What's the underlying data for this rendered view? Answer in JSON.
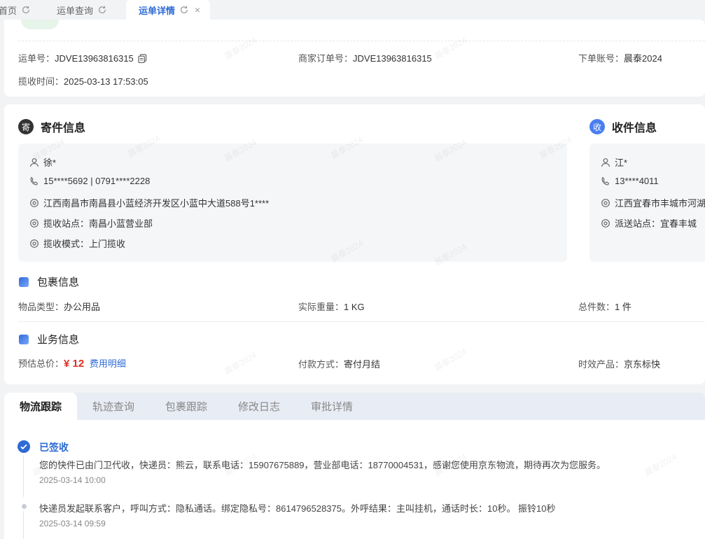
{
  "tabs": [
    {
      "label": "首页"
    },
    {
      "label": "运单查询"
    },
    {
      "label": "运单详情",
      "close": "×"
    }
  ],
  "overview": {
    "waybill_label": "运单号：",
    "waybill_value": "JDVE13963816315",
    "merchant_label": "商家订单号：",
    "merchant_value": "JDVE13963816315",
    "account_label": "下单账号：",
    "account_value": "晨泰2024",
    "pickup_time_label": "揽收时间：",
    "pickup_time_value": "2025-03-13 17:53:05"
  },
  "sender": {
    "badge": "寄",
    "title": "寄件信息",
    "name": "徐*",
    "phone": "15****5692 | 0791****2228",
    "address": "江西南昌市南昌县小蓝经济开发区小蓝中大道588号1****",
    "station": "揽收站点：南昌小蓝营业部",
    "mode": "揽收模式：上门揽收"
  },
  "receiver": {
    "badge": "收",
    "title": "收件信息",
    "name": "江*",
    "phone": "13****4011",
    "address": "江西宜春市丰城市河湖",
    "station": "派送站点：宜春丰城"
  },
  "package": {
    "title": "包裹信息",
    "type_label": "物品类型：",
    "type_value": "办公用品",
    "weight_label": "实际重量：",
    "weight_value": "1 KG",
    "count_label": "总件数：",
    "count_value": "1 件"
  },
  "business": {
    "title": "业务信息",
    "price_label": "预估总价：",
    "price_value": "¥ 12",
    "price_link": "费用明细",
    "payment_label": "付款方式：",
    "payment_value": "寄付月结",
    "product_label": "时效产品：",
    "product_value": "京东标快"
  },
  "bottom_tabs": [
    "物流跟踪",
    "轨迹查询",
    "包裹跟踪",
    "修改日志",
    "审批详情"
  ],
  "timeline": [
    {
      "title": "已签收",
      "desc": "您的快件已由门卫代收，快递员：熊云，联系电话：15907675889，营业部电话：18770004531，感谢您使用京东物流，期待再次为您服务。",
      "time": "2025-03-14 10:00"
    },
    {
      "desc": "快递员发起联系客户，呼叫方式：隐私通话。绑定隐私号：8614796528375。外呼结果：主叫挂机，通话时长：10秒。 振铃10秒",
      "time": "2025-03-14 09:59"
    }
  ],
  "watermark": "晨泰2024",
  "colors": {
    "accent": "#2f6bd6",
    "price": "#e02e24"
  }
}
